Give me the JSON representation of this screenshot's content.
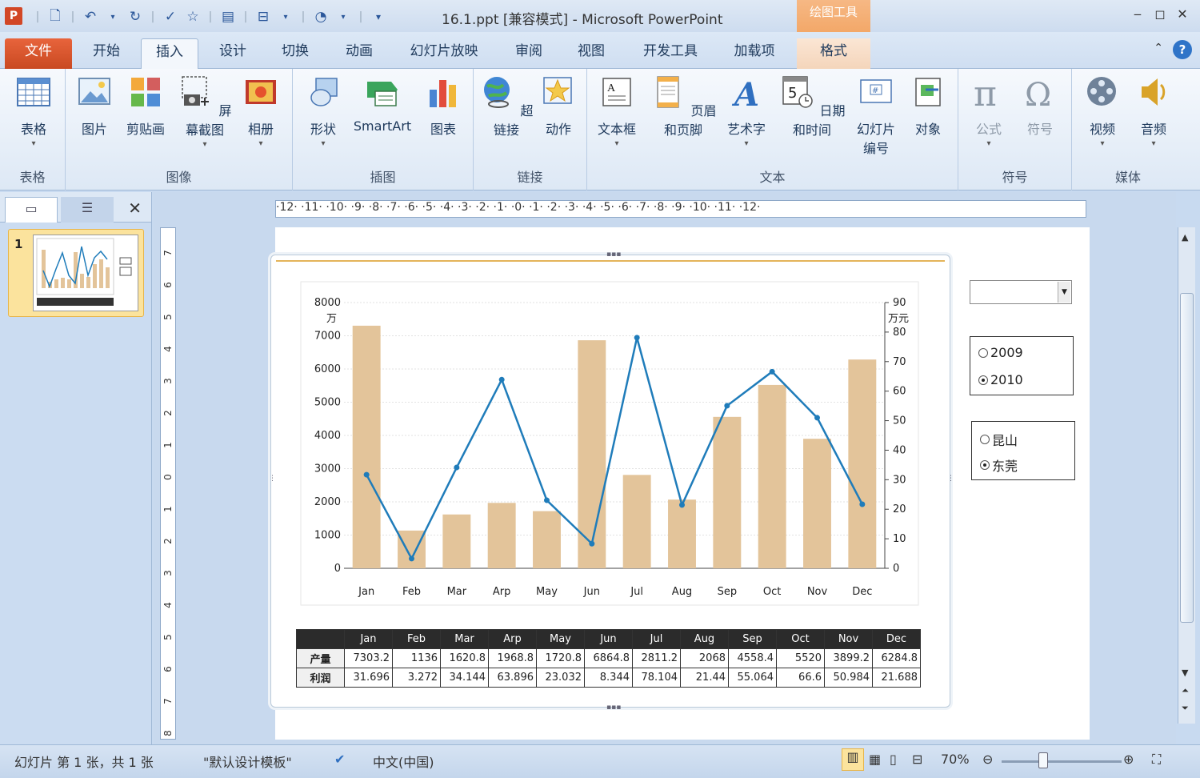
{
  "title_bar": {
    "title": "16.1.ppt [兼容模式]  -  Microsoft PowerPoint",
    "context_tab_header": "绘图工具",
    "app_icon_letter": "P"
  },
  "tabs": [
    "文件",
    "开始",
    "插入",
    "设计",
    "切换",
    "动画",
    "幻灯片放映",
    "审阅",
    "视图",
    "开发工具",
    "加载项",
    "格式"
  ],
  "ribbon": {
    "groups": [
      {
        "label": "表格",
        "buttons": [
          "表格"
        ]
      },
      {
        "label": "图像",
        "buttons": [
          "图片",
          "剪贴画",
          "屏幕截图",
          "相册"
        ]
      },
      {
        "label": "插图",
        "buttons": [
          "形状",
          "SmartArt",
          "图表"
        ]
      },
      {
        "label": "链接",
        "buttons": [
          "超链接",
          "动作"
        ]
      },
      {
        "label": "文本",
        "buttons": [
          "文本框",
          "页眉和页脚",
          "艺术字",
          "日期和时间",
          "幻灯片",
          "对象"
        ],
        "slide_number_second_line": "编号"
      },
      {
        "label": "符号",
        "buttons": [
          "公式",
          "符号"
        ]
      },
      {
        "label": "媒体",
        "buttons": [
          "视频",
          "音频"
        ]
      }
    ]
  },
  "slides_panel": {
    "slide_number": "1"
  },
  "ruler": {
    "horizontal": "·12·  ·11·  ·10·  ·9·  ·8·  ·7·  ·6·  ·5·  ·4·  ·3·  ·2·  ·1·  ·0·  ·1·  ·2·  ·3·  ·4·  ·5·  ·6·  ·7·  ·8·  ·9·  ·10·  ·11·  ·12·",
    "vertical": [
      "7",
      "6",
      "5",
      "4",
      "3",
      "2",
      "1",
      "0",
      "1",
      "2",
      "3",
      "4",
      "5",
      "6",
      "7",
      "8"
    ]
  },
  "controls": {
    "year_options": [
      {
        "label": "2009",
        "selected": false
      },
      {
        "label": "2010",
        "selected": true
      }
    ],
    "city_options": [
      {
        "label": "昆山",
        "selected": false
      },
      {
        "label": "东莞",
        "selected": true
      }
    ]
  },
  "chart_data": {
    "type": "bar",
    "categories": [
      "Jan",
      "Feb",
      "Mar",
      "Arp",
      "May",
      "Jun",
      "Jul",
      "Aug",
      "Sep",
      "Oct",
      "Nov",
      "Dec"
    ],
    "series": [
      {
        "name": "产量",
        "type": "bar",
        "axis": "left",
        "color": "#e3c49a",
        "values": [
          7303.2,
          1136,
          1620.8,
          1968.8,
          1720.8,
          6864.8,
          2811.2,
          2068,
          4558.4,
          5520,
          3899.2,
          6284.8
        ]
      },
      {
        "name": "利润",
        "type": "line",
        "axis": "right",
        "color": "#1f7cba",
        "values": [
          31.696,
          3.272,
          34.144,
          63.896,
          23.032,
          8.344,
          78.104,
          21.44,
          55.064,
          66.6,
          50.984,
          21.688
        ]
      }
    ],
    "y_left": {
      "min": 0,
      "max": 8000,
      "ticks": [
        0,
        1000,
        2000,
        3000,
        4000,
        5000,
        6000,
        7000,
        8000
      ],
      "unit": "万"
    },
    "y_right": {
      "min": 0,
      "max": 90,
      "ticks": [
        0,
        10,
        20,
        30,
        40,
        50,
        60,
        70,
        80,
        90
      ],
      "unit": "万元"
    },
    "grid": true,
    "legend": "none"
  },
  "table": {
    "row_labels": [
      "产量",
      "利润"
    ],
    "rows": [
      [
        "7303.2",
        "1136",
        "1620.8",
        "1968.8",
        "1720.8",
        "6864.8",
        "2811.2",
        "2068",
        "4558.4",
        "5520",
        "3899.2",
        "6284.8"
      ],
      [
        "31.696",
        "3.272",
        "34.144",
        "63.896",
        "23.032",
        "8.344",
        "78.104",
        "21.44",
        "55.064",
        "66.6",
        "50.984",
        "21.688"
      ]
    ]
  },
  "status_bar": {
    "slide_info": "幻灯片 第 1 张，共 1 张",
    "theme": "\"默认设计模板\"",
    "language": "中文(中国)",
    "zoom": "70%"
  }
}
